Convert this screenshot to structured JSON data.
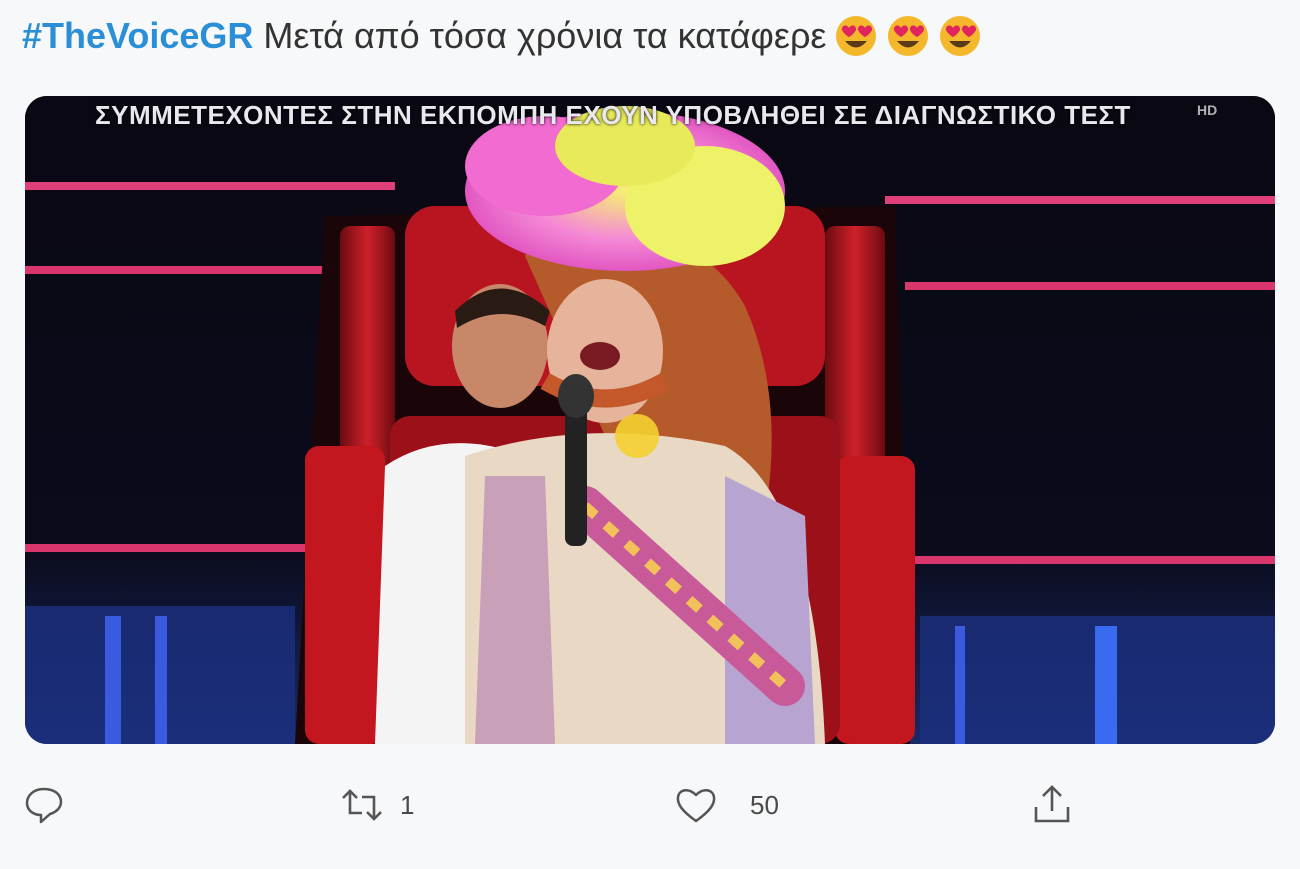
{
  "tweet": {
    "hashtag": "#TheVoiceGR",
    "text": "Μετά από τόσα χρόνια τα κατάφερε",
    "emojis": [
      "heart-eyes-emoji",
      "heart-eyes-emoji",
      "heart-eyes-emoji"
    ]
  },
  "media": {
    "ticker": "ΣΥΜΜΕΤΕΧΟΝΤΕΣ ΣΤΗΝ ΕΚΠΟΜΠΗ ΕΧΟΥΝ ΥΠΟΒΛΗΘΕΙ ΣΕ ΔΙΑΓΝΩΣΤΙΚΟ ΤΕΣΤ",
    "badge": "HD"
  },
  "actions": {
    "reply": {
      "icon": "reply-icon",
      "count": ""
    },
    "retweet": {
      "icon": "retweet-icon",
      "count": "1"
    },
    "like": {
      "icon": "heart-icon",
      "count": "50"
    },
    "share": {
      "icon": "share-icon",
      "count": ""
    }
  },
  "colors": {
    "hashtag": "#2a8fd6",
    "text": "#333333",
    "icons": "#555555"
  }
}
